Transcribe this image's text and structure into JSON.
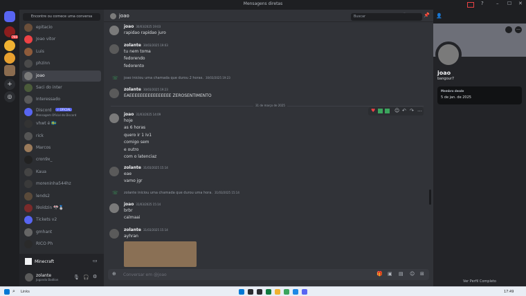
{
  "window": {
    "title": "Mensagens diretas",
    "minimize": "–",
    "maximize": "☐",
    "close": "✕"
  },
  "servers": [
    {
      "badge": ""
    },
    {
      "badge": "766"
    },
    {
      "badge": ""
    },
    {
      "badge": ""
    },
    {
      "badge": ""
    }
  ],
  "dm_search_placeholder": "Encontre ou comece uma conversa",
  "dms": [
    {
      "name": "epitacio",
      "color": "#6b4f3a"
    },
    {
      "name": "Joao vitor",
      "color": "#ed4245"
    },
    {
      "name": "Luis",
      "color": "#8e5b3b"
    },
    {
      "name": "phzinn",
      "color": "#4a4a4a"
    },
    {
      "name": "joao",
      "color": "#7a7a7a"
    },
    {
      "name": "Saci do inter",
      "color": "#4b5b3a"
    },
    {
      "name": "Interessado",
      "color": "#5a5a5a"
    },
    {
      "name": "Discord",
      "color": "#5865f2",
      "badge": "✓ OFICIAL",
      "sub": "Mensagem Oficial do Discord"
    },
    {
      "name": "vhwt é 🇸🇪",
      "color": "#333333"
    },
    {
      "name": "rick",
      "color": "#555555"
    },
    {
      "name": "Marcos",
      "color": "#9a7a5a"
    },
    {
      "name": "cron9x_",
      "color": "#222222"
    },
    {
      "name": "Kaua",
      "color": "#444444"
    },
    {
      "name": "moreninha544hz",
      "color": "#3a3a3a"
    },
    {
      "name": "lends2",
      "color": "#5a4a3a"
    },
    {
      "name": "l9oldzin 🎌🥈",
      "color": "#7a2a2a"
    },
    {
      "name": "Tickets v2",
      "color": "#5865f2"
    },
    {
      "name": "gmhant",
      "color": "#666666"
    },
    {
      "name": "RICO Ph",
      "color": "#2a2a2a"
    }
  ],
  "game": {
    "name": "Minecraft"
  },
  "user": {
    "name": "zolante",
    "status": "Jogando Badlion"
  },
  "chat_header": {
    "name": "joao"
  },
  "search_placeholder": "Buscar",
  "messages": [
    {
      "author": "joao",
      "time": "30/03/2025 19:03",
      "color": "#7a7a7a",
      "lines": [
        "rapidao rapidao juro"
      ]
    },
    {
      "author": "zolante",
      "time": "30/03/2025 19:03",
      "color": "#5a5a5a",
      "lines": [
        "tu nem toma",
        "fedorendo",
        "fedorento"
      ]
    },
    {
      "call": "joao iniciou uma chamada que durou 2 horas.",
      "time": "30/03/2025 19:23"
    },
    {
      "author": "zolante",
      "time": "30/03/2025 19:23",
      "color": "#5a5a5a",
      "lines": [
        "EAEEEEEEEEEEEEEEEE ZEROSENTIMENTO"
      ]
    },
    {
      "author": "joao",
      "time": "31/03/2025 14:09",
      "color": "#7a7a7a",
      "lines": [
        "hoje",
        "as 6 horas",
        "quero ir 1 Iv1",
        "comigo sem",
        "e outro",
        "com o latenciaz"
      ]
    },
    {
      "author": "zolante",
      "time": "31/03/2025 15:14",
      "color": "#5a5a5a",
      "lines": [
        "eae",
        "vamo jgr"
      ]
    },
    {
      "call": "zolante iniciou uma chamada que durou uma hora.",
      "time": "31/03/2025 15:14"
    },
    {
      "author": "joao",
      "time": "31/03/2025 15:14",
      "color": "#7a7a7a",
      "lines": [
        "brbr",
        "calmaai"
      ]
    },
    {
      "author": "zolante",
      "time": "31/03/2025 15:14",
      "color": "#5a5a5a",
      "lines": [
        "ayhran"
      ]
    }
  ],
  "date_divider": "31 de março de 2025",
  "composer_placeholder": "Conversar em @joao",
  "profile": {
    "display_name": "joao",
    "username": "bangour7",
    "member_since_label": "Membro desde",
    "member_since": "5 de jan. de 2025",
    "view_full": "Ver Perfil Completo"
  },
  "taskbar": {
    "search": "Links",
    "time": "17:49",
    "date": ""
  }
}
